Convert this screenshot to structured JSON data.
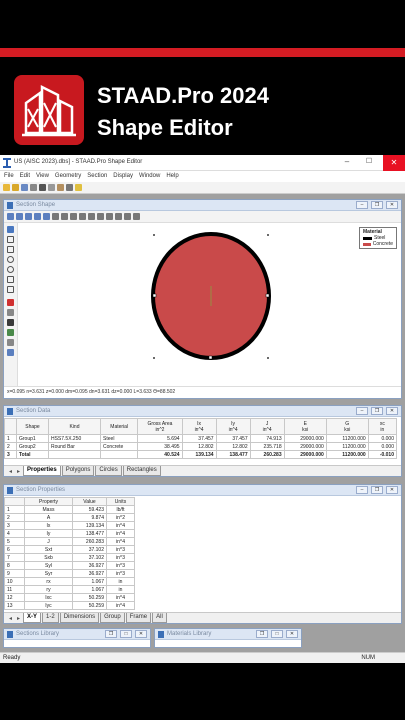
{
  "banner": {
    "title": "STAAD.Pro 2024",
    "subtitle": "Shape Editor"
  },
  "colors": {
    "accent_red": "#d41c23",
    "steel": "#000000",
    "concrete": "#c94a4a"
  },
  "window": {
    "title": "US (AISC 2023).dbs] - STAAD.Pro Shape Editor",
    "menu": [
      "File",
      "Edit",
      "View",
      "Geometry",
      "Section",
      "Display",
      "Window",
      "Help"
    ]
  },
  "section_shape": {
    "title": "Section Shape",
    "legend": {
      "heading": "Material",
      "items": [
        {
          "label": "Steel",
          "color": "#000000"
        },
        {
          "label": "Concrete",
          "color": "#c94a4a"
        }
      ]
    },
    "status": "x=0.095 n=3.631 z=0.000 dm=0.095 dn=3.631 dz=0.000 L=3.633 Θ=88.502"
  },
  "section_data": {
    "title": "Section Data",
    "headers": [
      "",
      "Shape",
      "Kind",
      "Material",
      "Gross Area\nin^2",
      "Ix\nin^4",
      "Iy\nin^4",
      "J\nin^4",
      "E\nksi",
      "G\nksi",
      "xc\nin"
    ],
    "rows": [
      [
        "1",
        "Group1",
        "HSS7.5X.250",
        "Steel",
        "5.694",
        "37.457",
        "37.457",
        "74.913",
        "29000.000",
        "11200.000",
        "0.000"
      ],
      [
        "2",
        "Group2",
        "Round Bar",
        "Concrete",
        "38.495",
        "12.802",
        "12.802",
        "235.718",
        "29000.000",
        "11200.000",
        "0.000"
      ],
      [
        "3",
        "Total",
        "",
        "",
        "40.524",
        "139.134",
        "138.477",
        "260.283",
        "29000.000",
        "11200.000",
        "-0.010"
      ]
    ],
    "tabs": [
      "Properties",
      "Polygons",
      "Circles",
      "Rectangles"
    ]
  },
  "section_properties": {
    "title": "Section Properties",
    "headers": [
      "",
      "Property",
      "Value",
      "Units"
    ],
    "rows": [
      [
        "1",
        "Mass",
        "59.423",
        "lb/ft"
      ],
      [
        "2",
        "A",
        "9.874",
        "in^2"
      ],
      [
        "3",
        "Ix",
        "139.134",
        "in^4"
      ],
      [
        "4",
        "Iy",
        "138.477",
        "in^4"
      ],
      [
        "5",
        "J",
        "260.283",
        "in^4"
      ],
      [
        "6",
        "Sxt",
        "37.102",
        "in^3"
      ],
      [
        "7",
        "Sxb",
        "37.102",
        "in^3"
      ],
      [
        "8",
        "Syl",
        "36.927",
        "in^3"
      ],
      [
        "9",
        "Syr",
        "36.927",
        "in^3"
      ],
      [
        "10",
        "rx",
        "1.067",
        "in"
      ],
      [
        "11",
        "ry",
        "1.067",
        "in"
      ],
      [
        "12",
        "Ixc",
        "50.259",
        "in^4"
      ],
      [
        "13",
        "Iyc",
        "50.259",
        "in^4"
      ]
    ],
    "tabs": [
      "X-Y",
      "1-2",
      "Dimensions",
      "Group",
      "Frame",
      "All"
    ]
  },
  "bottom_panels": {
    "left": "Sections Library",
    "right": "Materials Library"
  },
  "statusbar": {
    "ready": "Ready",
    "num": "NUM"
  }
}
